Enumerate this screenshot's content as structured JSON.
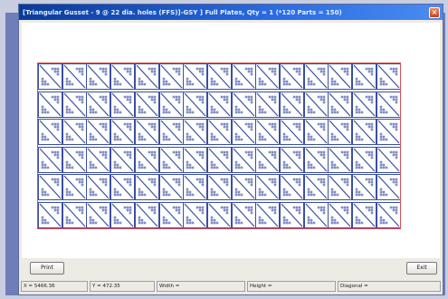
{
  "window": {
    "title": "[Triangular Gusset - 9 @ 22 dia. holes (FFS)]-GSY ] Full Plates, Qty = 1 (*120 Parts = 150)",
    "close_label": "×"
  },
  "nesting_grid": {
    "columns": 15,
    "rows": 6
  },
  "buttons": {
    "print_label": "Print",
    "exit_label": "Exit"
  },
  "status": {
    "x": "X = 5466.36",
    "y": "Y = 472.35",
    "width": "Width =",
    "height": "Height =",
    "diagonal": "Diagonal ="
  },
  "colors": {
    "title_bar": "#1f5ad0",
    "part_outline": "#3a4fa0",
    "plate_outline": "#e05050"
  }
}
